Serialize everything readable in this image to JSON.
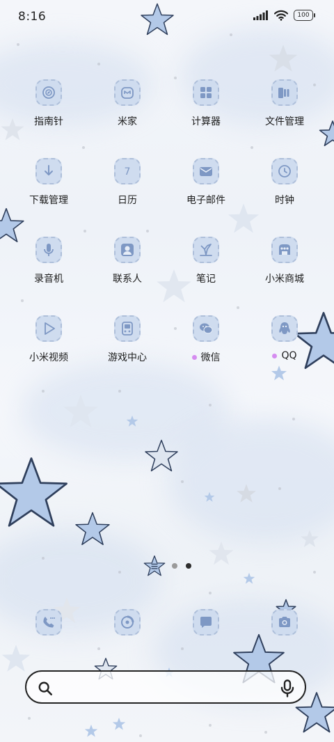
{
  "status_bar": {
    "time": "8:16",
    "battery": "100"
  },
  "apps": [
    {
      "label": "指南针",
      "icon": "compass-icon"
    },
    {
      "label": "米家",
      "icon": "mijia-icon"
    },
    {
      "label": "计算器",
      "icon": "calculator-icon"
    },
    {
      "label": "文件管理",
      "icon": "folder-icon"
    },
    {
      "label": "下载管理",
      "icon": "download-icon"
    },
    {
      "label": "日历",
      "icon": "calendar-icon",
      "badge": "7"
    },
    {
      "label": "电子邮件",
      "icon": "mail-icon"
    },
    {
      "label": "时钟",
      "icon": "clock-icon"
    },
    {
      "label": "录音机",
      "icon": "microphone-icon"
    },
    {
      "label": "联系人",
      "icon": "contacts-icon"
    },
    {
      "label": "笔记",
      "icon": "notes-icon"
    },
    {
      "label": "小米商城",
      "icon": "store-icon"
    },
    {
      "label": "小米视频",
      "icon": "video-icon"
    },
    {
      "label": "游戏中心",
      "icon": "game-icon"
    },
    {
      "label": "微信",
      "icon": "wechat-icon",
      "new": true
    },
    {
      "label": "QQ",
      "icon": "qq-icon",
      "new": true
    }
  ],
  "dock": [
    "phone-icon",
    "browser-icon",
    "messages-icon",
    "camera-icon"
  ],
  "pager": {
    "pages": 2,
    "active": 2
  },
  "colors": {
    "icon_bg": "#cfdcef",
    "icon_stroke": "#7e98c4",
    "new_dot": "#d58cf0",
    "star_blue": "#b3c9e8"
  }
}
